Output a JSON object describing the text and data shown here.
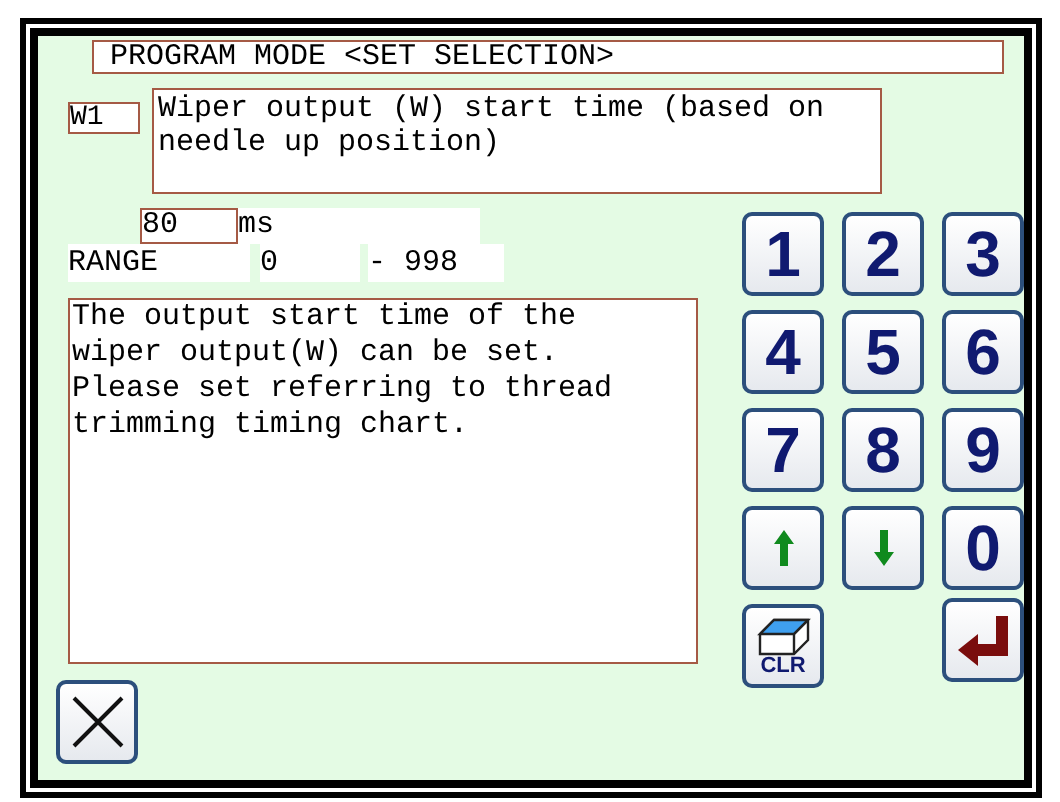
{
  "title": "PROGRAM MODE <SET SELECTION>",
  "parameter": {
    "code": "W1",
    "description": "Wiper output (W) start time (based on needle up position)"
  },
  "value": {
    "value": "80",
    "unit": "ms"
  },
  "range": {
    "label": "RANGE",
    "min": "0",
    "separator": "-",
    "max": "998"
  },
  "help_lines": [
    "The output start time of the",
    "wiper output(W) can be set.",
    "Please set referring to thread",
    "trimming timing chart."
  ],
  "keypad": [
    {
      "kind": "digit",
      "label": "1"
    },
    {
      "kind": "digit",
      "label": "2"
    },
    {
      "kind": "digit",
      "label": "3"
    },
    {
      "kind": "digit",
      "label": "4"
    },
    {
      "kind": "digit",
      "label": "5"
    },
    {
      "kind": "digit",
      "label": "6"
    },
    {
      "kind": "digit",
      "label": "7"
    },
    {
      "kind": "digit",
      "label": "8"
    },
    {
      "kind": "digit",
      "label": "9"
    },
    {
      "kind": "up"
    },
    {
      "kind": "down"
    },
    {
      "kind": "digit",
      "label": "0"
    },
    {
      "kind": "clear",
      "label": "CLR"
    }
  ],
  "buttons": [
    {
      "kind": "cancel"
    },
    {
      "kind": "enter"
    }
  ]
}
